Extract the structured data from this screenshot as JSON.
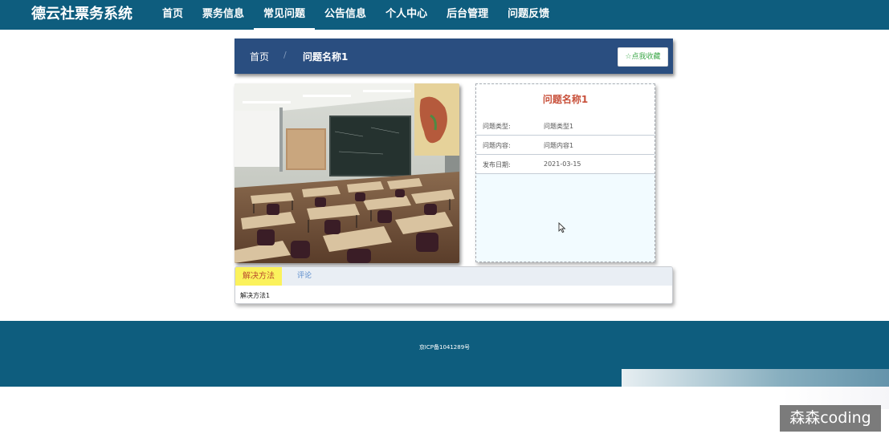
{
  "header": {
    "brand": "德云社票务系统",
    "nav": [
      {
        "label": "首页",
        "active": false
      },
      {
        "label": "票务信息",
        "active": false
      },
      {
        "label": "常见问题",
        "active": true
      },
      {
        "label": "公告信息",
        "active": false
      },
      {
        "label": "个人中心",
        "active": false
      },
      {
        "label": "后台管理",
        "active": false
      },
      {
        "label": "问题反馈",
        "active": false
      }
    ]
  },
  "breadcrumb": {
    "home": "首页",
    "separator": "/",
    "current": "问题名称1"
  },
  "favorite_button": {
    "icon": "star-outline-icon",
    "label": "点我收藏"
  },
  "detail": {
    "title": "问题名称1",
    "rows": [
      {
        "label": "问题类型:",
        "value": "问题类型1"
      },
      {
        "label": "问题内容:",
        "value": "问题内容1"
      },
      {
        "label": "发布日期:",
        "value": "2021-03-15"
      }
    ]
  },
  "tabs": {
    "items": [
      {
        "label": "解决方法",
        "active": true
      },
      {
        "label": "评论",
        "active": false
      }
    ],
    "content": "解决方法1"
  },
  "footer": {
    "icp": "京ICP备1041289号"
  },
  "watermark": "森森coding",
  "colors": {
    "header_bg": "#0e5d7e",
    "breadcrumb_bg": "#2a4e80",
    "title_red": "#c8503a",
    "tab_active_bg": "#fbf25c",
    "favorite_green": "#3ea84a"
  }
}
